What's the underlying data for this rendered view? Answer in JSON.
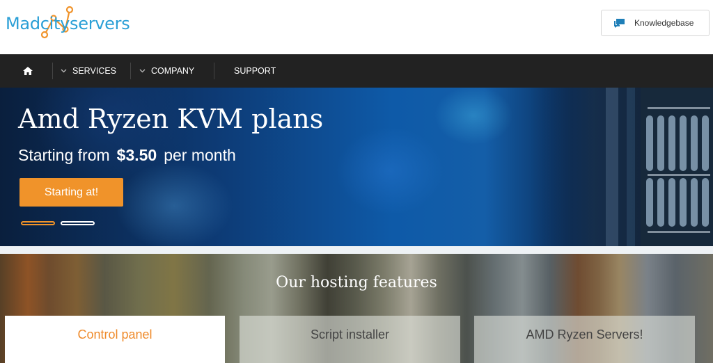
{
  "brand": {
    "name": "Madcityservers",
    "color": "#2a9fd6",
    "accent": "#f0932a"
  },
  "header": {
    "knowledgebase_label": "Knowledgebase",
    "knowledgebase_icon": "chat-bubbles-icon"
  },
  "nav": {
    "home_icon": "home-icon",
    "items": [
      {
        "label": "SERVICES",
        "has_dropdown": true
      },
      {
        "label": "COMPANY",
        "has_dropdown": true
      },
      {
        "label": "SUPPORT",
        "has_dropdown": false
      }
    ]
  },
  "hero": {
    "title": "Amd Ryzen KVM plans",
    "subtitle_prefix": "Starting from",
    "price": "$3.50",
    "subtitle_suffix": "per month",
    "cta_label": "Starting at!",
    "slides": 2,
    "active_slide": 1
  },
  "features": {
    "title": "Our hosting features",
    "cards": [
      {
        "label": "Control panel",
        "active": true
      },
      {
        "label": "Script installer",
        "active": false
      },
      {
        "label": "AMD Ryzen Servers!",
        "active": false
      }
    ]
  }
}
